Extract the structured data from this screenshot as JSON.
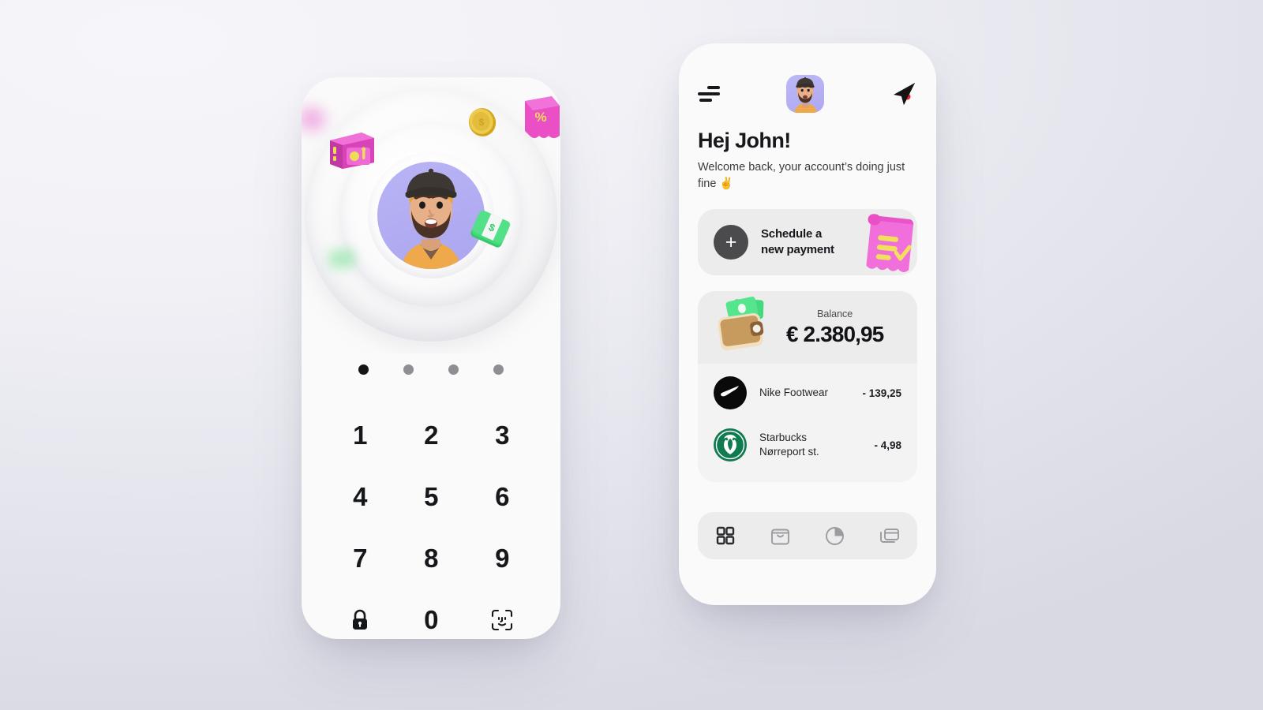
{
  "background": {
    "gradient_from": "#f4f4f8",
    "gradient_to": "#d6d6e0"
  },
  "left_phone": {
    "name": "lock-screen",
    "illustration": {
      "avatar_bg": "#b4afef",
      "floating_items": [
        "pink-safe",
        "gold-coin",
        "green-money-stack",
        "pink-percent-tag"
      ]
    },
    "pager": {
      "total": 4,
      "active_index": 0
    },
    "keypad": {
      "keys": [
        {
          "label": "1",
          "type": "digit"
        },
        {
          "label": "2",
          "type": "digit"
        },
        {
          "label": "3",
          "type": "digit"
        },
        {
          "label": "4",
          "type": "digit"
        },
        {
          "label": "5",
          "type": "digit"
        },
        {
          "label": "6",
          "type": "digit"
        },
        {
          "label": "7",
          "type": "digit"
        },
        {
          "label": "8",
          "type": "digit"
        },
        {
          "label": "9",
          "type": "digit"
        },
        {
          "label": "",
          "type": "lock-icon"
        },
        {
          "label": "0",
          "type": "digit"
        },
        {
          "label": "",
          "type": "face-id-icon"
        }
      ]
    }
  },
  "right_phone": {
    "name": "dashboard",
    "topbar": {
      "menu_icon": "hamburger-menu-icon",
      "avatar": "user-avatar",
      "send_icon": "send-plane-icon",
      "notification_dot_color": "#e8232a"
    },
    "greeting": {
      "title": "Hej John!",
      "subtitle": "Welcome back, your account’s doing just fine ✌"
    },
    "schedule_card": {
      "plus_label": "+",
      "line1": "Schedule a",
      "line2": "new payment",
      "art": "pink-receipt"
    },
    "balance_card": {
      "label": "Balance",
      "value": "€ 2.380,95",
      "art": "wallet-with-cash"
    },
    "transactions": [
      {
        "merchant": "Nike Footwear",
        "sub": "",
        "amount": "- 139,25",
        "logo": "nike-logo",
        "logo_color": "#0a0a0a"
      },
      {
        "merchant": "Starbucks",
        "sub": "Nørreport st.",
        "amount": "- 4,98",
        "logo": "starbucks-logo",
        "logo_color": "#0f7b4f"
      }
    ],
    "bottom_nav": [
      {
        "icon": "grid-dashboard-icon",
        "active": true
      },
      {
        "icon": "shopping-bag-icon",
        "active": false
      },
      {
        "icon": "pie-chart-icon",
        "active": false
      },
      {
        "icon": "cards-icon",
        "active": false
      }
    ]
  }
}
